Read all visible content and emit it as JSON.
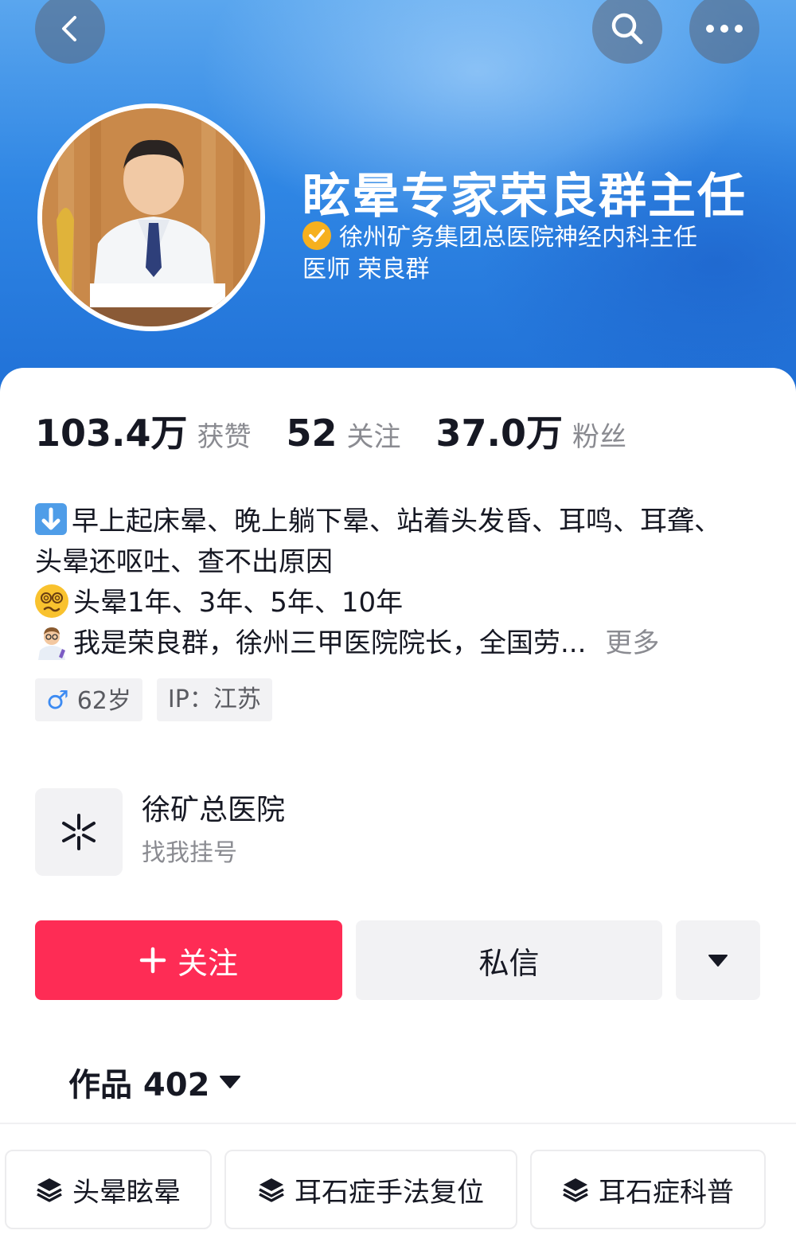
{
  "nav": {
    "back_icon": "chevron-left-icon",
    "search_icon": "search-icon",
    "more_icon": "ellipsis-icon"
  },
  "profile": {
    "nickname": "眩晕专家荣良群主任",
    "verification_line1": "徐州矿务集团总医院神经内科主任",
    "verification_line2": "医师 荣良群",
    "verify_color": "#f6b01e"
  },
  "stats": [
    {
      "value": "103.4万",
      "label": "获赞"
    },
    {
      "value": "52",
      "label": "关注"
    },
    {
      "value": "37.0万",
      "label": "粉丝"
    }
  ],
  "bio": {
    "line1": "早上起床晕、晚上躺下晕、站着头发昏、耳鸣、耳聋、",
    "line2": "头晕还呕吐、查不出原因",
    "line3": "头晕1年、3年、5年、10年",
    "line4": "我是荣良群，徐州三甲医院院长，全国劳...",
    "more": "更多"
  },
  "tags": {
    "age": "62岁",
    "ip": "IP：江苏"
  },
  "link_card": {
    "title": "徐矿总医院",
    "subtitle": "找我挂号"
  },
  "actions": {
    "follow": "关注",
    "message": "私信",
    "follow_color": "#fe2c55"
  },
  "works": {
    "label": "作品 402"
  },
  "collections": [
    {
      "label": "头晕眩晕"
    },
    {
      "label": "耳石症手法复位"
    },
    {
      "label": "耳石症科普"
    }
  ]
}
